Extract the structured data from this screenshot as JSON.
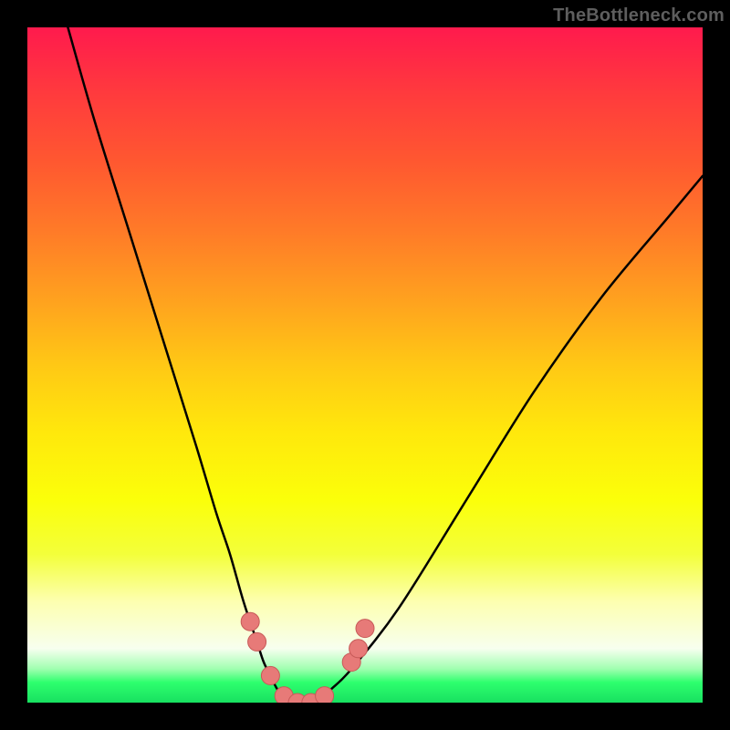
{
  "watermark": "TheBottleneck.com",
  "chart_data": {
    "type": "line",
    "title": "",
    "xlabel": "",
    "ylabel": "",
    "xlim": [
      0,
      100
    ],
    "ylim": [
      0,
      100
    ],
    "grid": false,
    "legend": false,
    "series": [
      {
        "name": "bottleneck-curve",
        "x": [
          6,
          10,
          15,
          20,
          25,
          28,
          30,
          32,
          34,
          35,
          36,
          37,
          38,
          40,
          42,
          44,
          45,
          48,
          55,
          65,
          75,
          85,
          95,
          100
        ],
        "y": [
          100,
          86,
          70,
          54,
          38,
          28,
          22,
          15,
          9,
          6,
          4,
          2,
          1,
          0,
          0,
          1,
          2,
          5,
          14,
          30,
          46,
          60,
          72,
          78
        ]
      }
    ],
    "markers": [
      {
        "name": "marker-1",
        "x": 33,
        "y": 12
      },
      {
        "name": "marker-2",
        "x": 34,
        "y": 9
      },
      {
        "name": "marker-3",
        "x": 36,
        "y": 4
      },
      {
        "name": "marker-4",
        "x": 38,
        "y": 1
      },
      {
        "name": "marker-5",
        "x": 40,
        "y": 0
      },
      {
        "name": "marker-6",
        "x": 42,
        "y": 0
      },
      {
        "name": "marker-7",
        "x": 44,
        "y": 1
      },
      {
        "name": "marker-8",
        "x": 48,
        "y": 6
      },
      {
        "name": "marker-9",
        "x": 49,
        "y": 8
      },
      {
        "name": "marker-10",
        "x": 50,
        "y": 11
      }
    ],
    "gradient_stops": [
      {
        "pos": 0,
        "color": "#ff1a4d"
      },
      {
        "pos": 50,
        "color": "#ffe80c"
      },
      {
        "pos": 85,
        "color": "#fdffb0"
      },
      {
        "pos": 100,
        "color": "#18e060"
      }
    ],
    "colors": {
      "curve": "#000000",
      "marker_fill": "#e77a78",
      "marker_stroke": "#c75a58",
      "frame": "#000000"
    }
  }
}
